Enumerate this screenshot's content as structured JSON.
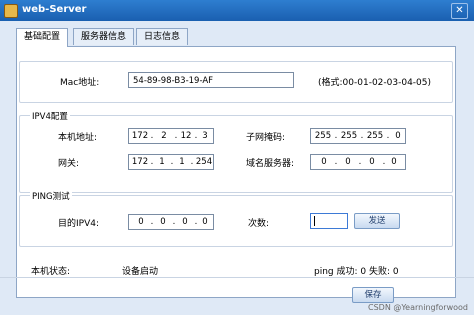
{
  "window": {
    "title": "web-Server",
    "close_glyph": "✕"
  },
  "tabs": [
    {
      "label": "基础配置"
    },
    {
      "label": "服务器信息"
    },
    {
      "label": "日志信息"
    }
  ],
  "mac": {
    "label": "Mac地址:",
    "value": "54-89-98-B3-19-AF",
    "hint": "(格式:00-01-02-03-04-05)"
  },
  "ipv4": {
    "title": "IPV4配置",
    "local_ip_label": "本机地址:",
    "local_ip": [
      "172",
      "2",
      "12",
      "3"
    ],
    "mask_label": "子网掩码:",
    "mask": [
      "255",
      "255",
      "255",
      "0"
    ],
    "gateway_label": "网关:",
    "gateway": [
      "172",
      "1",
      "1",
      "254"
    ],
    "dns_label": "域名服务器:",
    "dns": [
      "0",
      "0",
      "0",
      "0"
    ]
  },
  "ping": {
    "title": "PING测试",
    "target_label": "目的IPV4:",
    "target": [
      "0",
      "0",
      "0",
      "0"
    ],
    "count_label": "次数:",
    "count_value": "",
    "send_button": "发送"
  },
  "status": {
    "label": "本机状态:",
    "value": "设备启动",
    "ping_result": "ping 成功: 0 失败: 0"
  },
  "footer": {
    "save_button": "保存"
  },
  "watermark": "CSDN @Yearningforwood"
}
